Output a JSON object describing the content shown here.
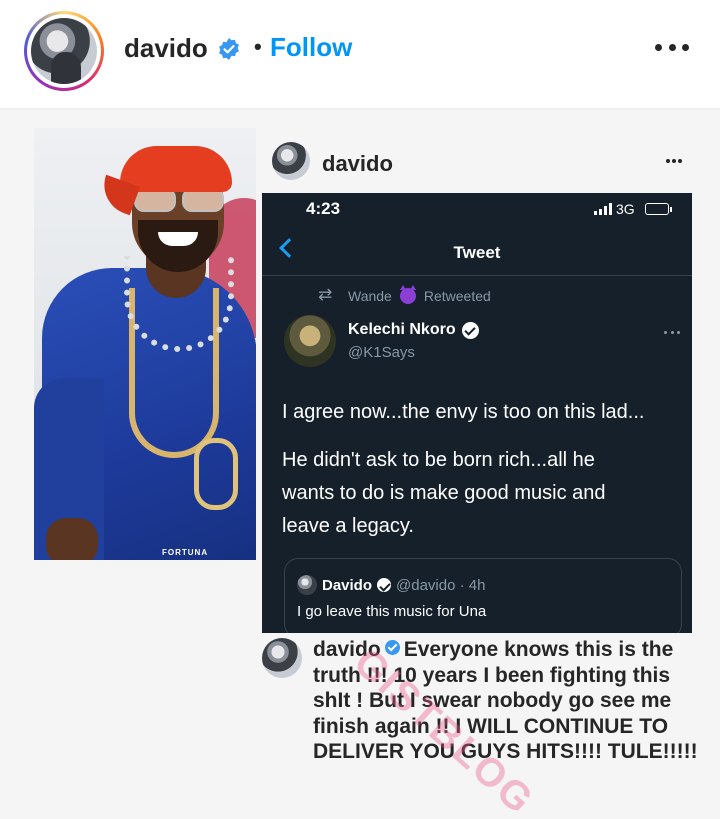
{
  "header": {
    "username": "davido",
    "separator": "•",
    "follow_label": "Follow",
    "avatar_icon": "profile-photo",
    "verified_icon": "verified-badge-icon",
    "more_icon": "more-options-icon"
  },
  "post_image": {
    "photo_watermark": "FORTUNA",
    "embedded_post": {
      "username": "davido"
    },
    "tweet_screenshot": {
      "status_time": "4:23",
      "network": "3G",
      "nav_title": "Tweet",
      "retweet_user": "Wande",
      "retweet_label": "Retweeted",
      "author_name": "Kelechi Nkoro",
      "author_handle": "@K1Says",
      "body_lines": [
        "I agree now...the envy is too on this lad...",
        "He didn't ask to be born rich...all he",
        "wants to do is make good music and",
        "leave a legacy."
      ],
      "quote": {
        "name": "Davido",
        "handle_time": "@davido · 4h",
        "text": "I go leave this music for Una"
      }
    },
    "caption": {
      "username": "davido",
      "text": "Everyone knows this is the truth !!! 10 years I been fighting this shIt !  But I swear nobody go see me finish again !! I WILL CONTINUE TO DELIVER YOU GUYS HITS!!!! TULE!!!!!"
    },
    "watermark_text": "GISTBLOG"
  },
  "colors": {
    "follow_blue": "#0095f6",
    "twitter_bg": "#15202b",
    "twitter_blue": "#1d9bf0",
    "watermark_pink": "#ec588c"
  }
}
